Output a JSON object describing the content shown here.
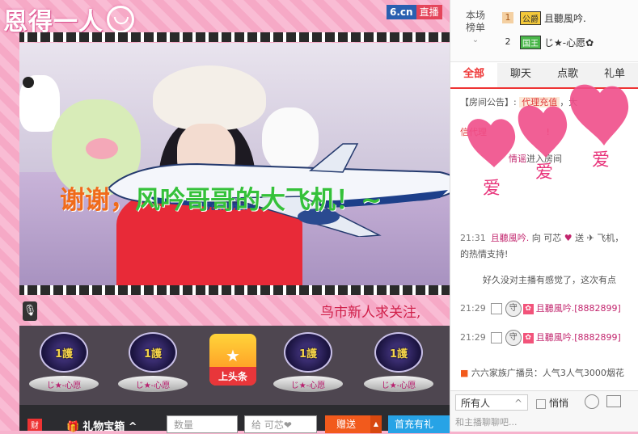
{
  "logo": {
    "text": "恩得一人"
  },
  "video": {
    "badge_site": "6.cn",
    "badge_live": "直播",
    "overlay_text_a": "谢谢，",
    "overlay_text_b": "风吟哥哥的大飞机！~",
    "ticker": "鸟市新人求关注,"
  },
  "guardians": [
    {
      "medal": "1護"
    },
    {
      "medal": "1護"
    },
    {
      "medal": "1護"
    },
    {
      "medal": "1護"
    }
  ],
  "guardian_names": [
    "じ★-心愿",
    "じ★-心愿",
    "じ★-心愿",
    "じ★-心愿"
  ],
  "headline": {
    "label": "上头条",
    "star": "★"
  },
  "bottom_bar": {
    "gift_box": "礼物宝箱",
    "gift_caret": "^",
    "qty_placeholder": "数量",
    "recipient": "给 可芯❤",
    "send": "赠送",
    "send_caret": "▲",
    "recharge": "首充有礼"
  },
  "rank": {
    "title_line1": "本场",
    "title_line2": "榜单",
    "rows": [
      {
        "num": "1",
        "level": "公爵",
        "name": "且聽風吟."
      },
      {
        "num": "2",
        "level": "国王",
        "name": "じ★-心愿✿"
      }
    ]
  },
  "tabs": [
    "全部",
    "聊天",
    "点歌",
    "礼单"
  ],
  "chat": {
    "notice_label": "【房间公告】:",
    "notice_tag": "代理充值",
    "notice_rest": "，大",
    "msg2_a": "信代理",
    "msg2_b": "!",
    "msg3_a": "情谣",
    "msg3_b": "进入房间",
    "gift_time": "21:31",
    "gift_text": "且聽風吟.",
    "gift_rest": "向 可芯",
    "gift_rest2": "送",
    "gift_rest3": "飞机，",
    "gift_line2": "的热情支持!",
    "msg5": "好久没对主播有感觉了，这次有点",
    "rows": [
      {
        "time": "21:29",
        "name": "且聽風吟.",
        "id": "[8882899]"
      },
      {
        "time": "21:29",
        "name": "且聽風吟.",
        "id": "[8882899]"
      }
    ],
    "broadcast": "六六家族广播员：人气3人气3000烟花"
  },
  "input": {
    "audience": "所有人",
    "private": "悄悄",
    "placeholder": "和主播聊聊吧..."
  },
  "colors": {
    "accent": "#e33333",
    "pink": "#f6a9c6",
    "name": "#c2256d"
  }
}
